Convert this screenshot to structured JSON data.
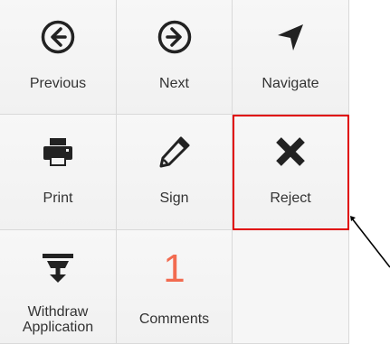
{
  "actions": {
    "previous_label": "Previous",
    "next_label": "Next",
    "navigate_label": "Navigate",
    "print_label": "Print",
    "sign_label": "Sign",
    "reject_label": "Reject",
    "withdraw_label_line1": "Withdraw",
    "withdraw_label_line2": "Application",
    "comments_label": "Comments",
    "comments_count": "1"
  },
  "icons": {
    "previous": "arrow-left-circle-icon",
    "next": "arrow-right-circle-icon",
    "navigate": "location-arrow-icon",
    "print": "printer-icon",
    "sign": "pencil-icon",
    "reject": "close-icon",
    "withdraw": "withdraw-icon"
  },
  "colors": {
    "tile_background": "#f4f4f4",
    "tile_border": "#d9d9d9",
    "icon_color": "#222222",
    "comments_count_color": "#f26b50",
    "highlight_color": "#e00000"
  }
}
